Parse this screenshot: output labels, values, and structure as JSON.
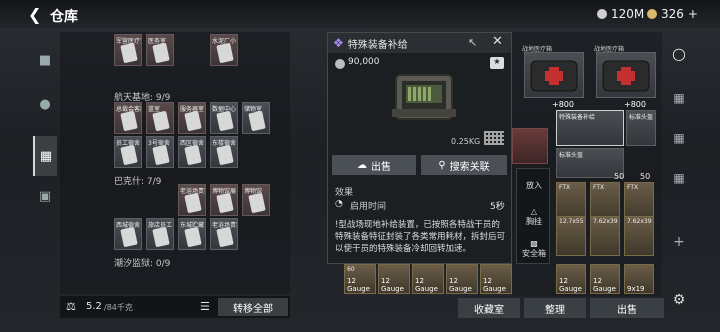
{
  "header": {
    "title": "仓库",
    "money1": "120M",
    "money2": "326",
    "plus": "+"
  },
  "left": {
    "sections": [
      {
        "label": "航天基地: 9/9"
      },
      {
        "label": "巴克什: 7/9"
      },
      {
        "label": "潮汐监狱: 0/9"
      }
    ],
    "row_top": [
      "",
      "",
      "",
      "",
      ""
    ],
    "row_top_labels": [
      "军营医疗室",
      "医务室",
      "",
      "水泥厂小",
      "水泥"
    ],
    "row_a": [
      "总裁会客厅",
      "蓝室",
      "服务器室",
      "数据中心",
      "储物"
    ],
    "row_b": [
      "员工宿舍",
      "3号",
      "西区宿舍",
      "东楼",
      ""
    ],
    "row_b_labels": [
      "员工宿舍",
      "3号宿舍",
      "西区宿舍",
      "东楼宿舍",
      ""
    ],
    "row_c": [
      "",
      "",
      "老浴场",
      "博物馆",
      "博物"
    ],
    "row_c_labels": [
      "",
      "",
      "老浴场贵宾",
      "博物馆展",
      "博物馆"
    ],
    "row_d": [
      "西城宿舍",
      "旅店员工",
      "东城贮藏",
      "老浴场监控",
      ""
    ],
    "row_d_labels": [
      "西城宿舍",
      "旅店员工",
      "东城贮藏",
      "老浴场贵宾厅",
      ""
    ],
    "row_a_labels": [
      "总裁会客厅",
      "蓝室",
      "服务器室",
      "数据中心",
      "储物室"
    ],
    "weight": "5.2",
    "weight_unit": "/84千克",
    "transfer_all": "转移全部"
  },
  "popup": {
    "name": "特殊装备补给",
    "price": "90,000",
    "weight": "0.25KG",
    "sell": "出售",
    "search": "搜索关联",
    "effect_title": "效果",
    "effect_label": "启用时间",
    "effect_value": "5秒",
    "description": "!型战场现地补给装置，已按照各特战干员的特殊装备特征封装了各类常用耗材，拆封后可以使干员的特殊装备冷却回转加速。"
  },
  "right": {
    "labels": [
      "战地医疗箱",
      "战地医疗箱",
      "特殊装备补给",
      "标准头盔",
      "标准头盔"
    ],
    "plus": "+800",
    "ammo": [
      "FTX",
      "FTX",
      "FTX",
      "12.7x55",
      "7.62x39",
      "7.62x39"
    ],
    "ammo_bottom": [
      "12 Gauge",
      "12 Gauge",
      "12 Gauge",
      "12 Gauge",
      "12 Gauge",
      "9x19"
    ],
    "side_put": "放入",
    "side_backpack": "胸挂",
    "side_safe": "安全箱",
    "hide": "收藏室",
    "arrange": "整理",
    "sell": "出售",
    "counts": {
      "50": "50",
      "60": "60",
      "2": "2"
    }
  },
  "colors": {
    "accent": "#ffffff",
    "red": "#7a2a2a"
  }
}
